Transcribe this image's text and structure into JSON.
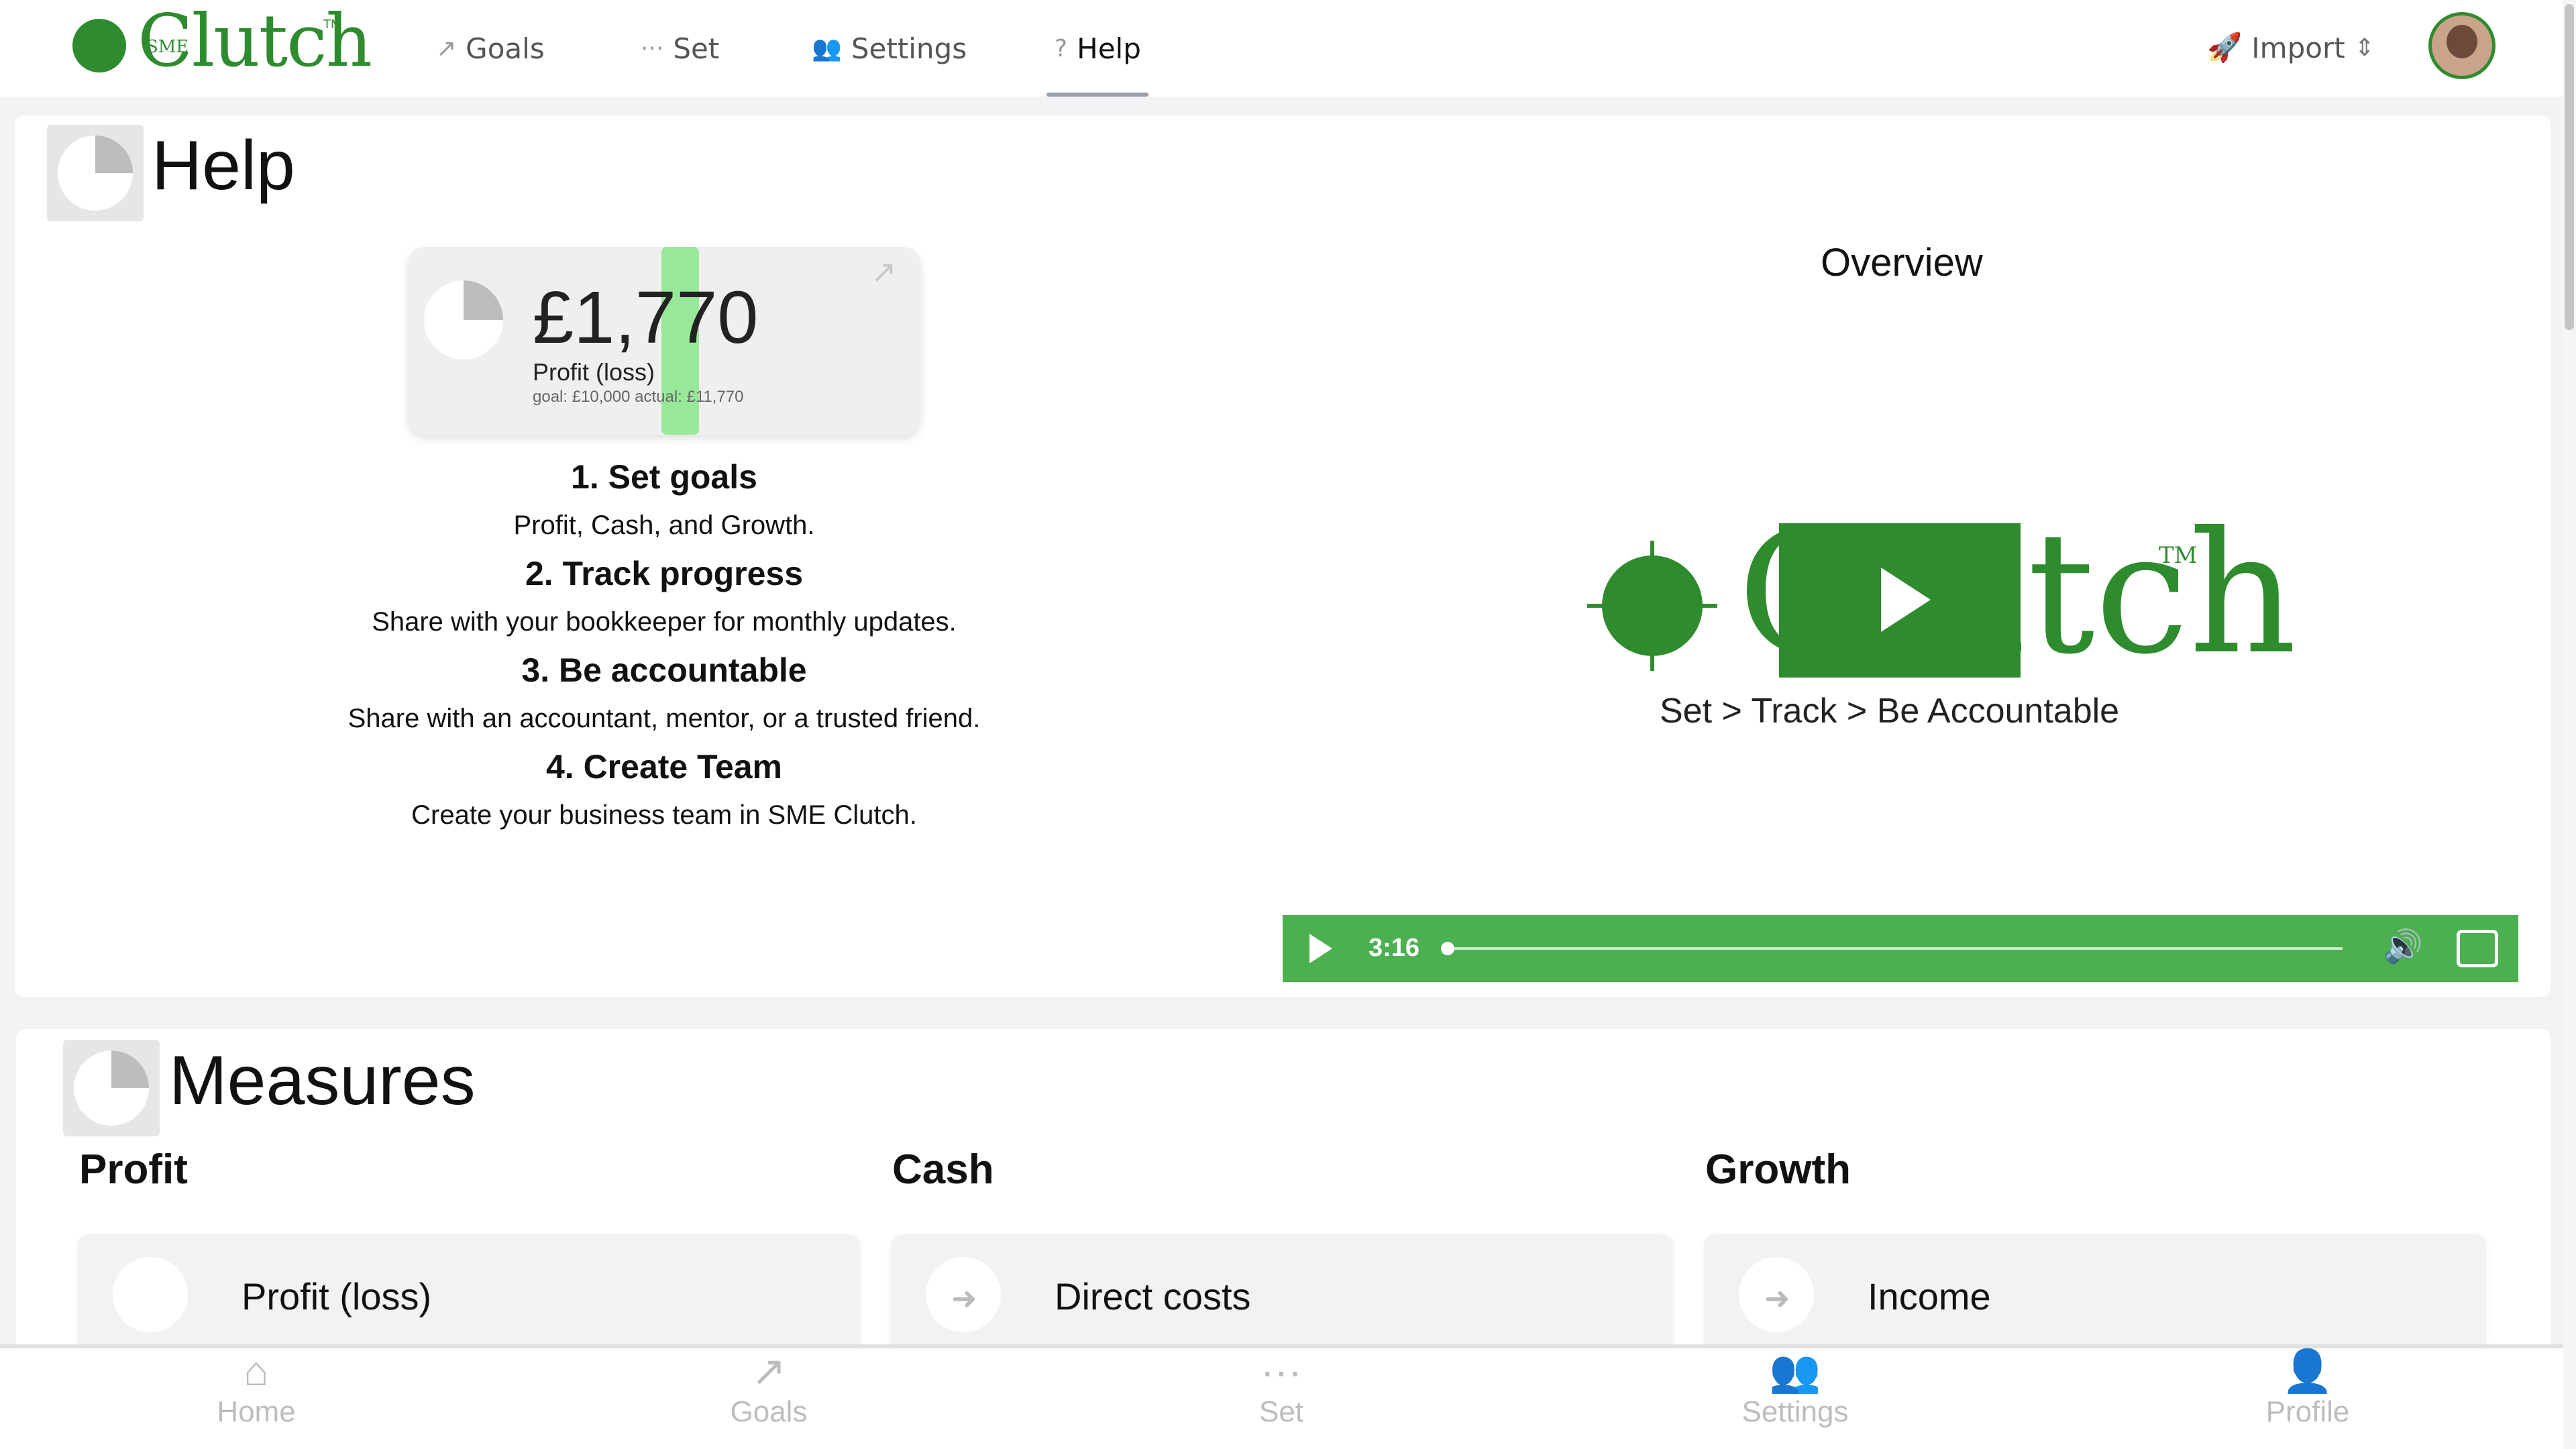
{
  "app": {
    "logo_text": "Clutch",
    "logo_small": "SME",
    "logo_tm": "TM"
  },
  "nav": {
    "items": [
      {
        "label": "Goals",
        "icon": "trend-icon"
      },
      {
        "label": "Set",
        "icon": "dots-icon"
      },
      {
        "label": "Settings",
        "icon": "users-gear-icon"
      },
      {
        "label": "Help",
        "icon": "question-icon"
      }
    ],
    "active": "Help",
    "import_label": "Import"
  },
  "help": {
    "title": "Help",
    "kpi": {
      "value": "£1,770",
      "label": "Profit (loss)",
      "sub": "goal: £10,000 actual: £11,770",
      "progress_fraction": 0.177
    },
    "steps": [
      {
        "title": "1. Set goals",
        "desc": "Profit, Cash, and Growth."
      },
      {
        "title": "2. Track progress",
        "desc": "Share with your bookkeeper for monthly updates."
      },
      {
        "title": "3. Be accountable",
        "desc": "Share with an accountant, mentor, or a trusted friend."
      },
      {
        "title": "4. Create Team",
        "desc": "Create your business team in SME Clutch."
      }
    ],
    "video": {
      "title": "Overview",
      "brand_word": "Clutch",
      "tm": "TM",
      "tagline": "Set > Track > Be Accountable",
      "time": "3:16",
      "progress_fraction": 0.0
    }
  },
  "measures": {
    "title": "Measures",
    "columns": [
      {
        "heading": "Profit",
        "first_item": "Profit (loss)"
      },
      {
        "heading": "Cash",
        "first_item": "Direct costs"
      },
      {
        "heading": "Growth",
        "first_item": "Income"
      }
    ]
  },
  "bottom_nav": [
    {
      "label": "Home",
      "icon": "home-icon"
    },
    {
      "label": "Goals",
      "icon": "trend-icon"
    },
    {
      "label": "Set",
      "icon": "dots-icon"
    },
    {
      "label": "Settings",
      "icon": "users-gear-icon"
    },
    {
      "label": "Profile",
      "icon": "user-gear-icon"
    }
  ],
  "colors": {
    "brand": "#2e8b2e",
    "video_controls": "#4caf50",
    "kpi_bar": "#98e89a"
  }
}
